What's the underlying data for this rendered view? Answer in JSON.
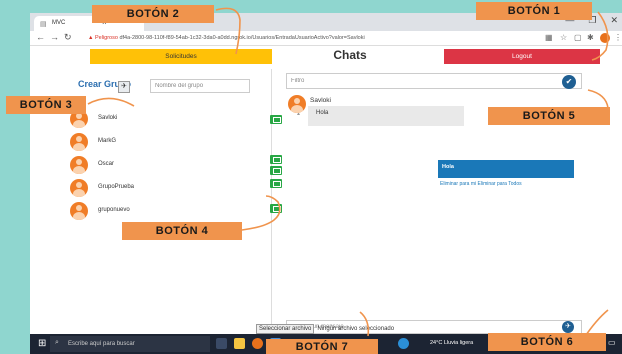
{
  "browser": {
    "tab_title": "MVC",
    "tab_close": "×",
    "new_tab": "+",
    "url_warning": "▲",
    "url_label": "Peligroso",
    "url": "df4a-2800-98-110f-f89-54ab-1c32-3da0-a0dd.ngrok.io/Usuarios/EntradaUsuarioActivo?valor=Savloki",
    "window_controls": [
      "—",
      "❐",
      "✕"
    ]
  },
  "header": {
    "solicitudes_label": "Solicitudes",
    "chats_title": "Chats",
    "logout_label": "Logout"
  },
  "left": {
    "crear_grupo": "Crear Grupo",
    "group_name_placeholder": "Nombre del grupo",
    "users": [
      {
        "name": "Savloki"
      },
      {
        "name": "MarkG"
      },
      {
        "name": "Oscar"
      },
      {
        "name": "GrupoPrueba"
      },
      {
        "name": "gruponuevo"
      }
    ]
  },
  "right": {
    "filtro_placeholder": "Filtro",
    "incoming_message": {
      "sender": "Savloki",
      "text": "Hola"
    },
    "outgoing_message": {
      "text": "Hola",
      "delete_link": "Eliminar para mi Eliminar para Todos"
    },
    "message_placeholder": "Escribe un mensaje",
    "file_button": "Seleccionar archivo",
    "file_status": "Ningún archivo seleccionado"
  },
  "taskbar": {
    "search_placeholder": "Escribe aquí para buscar",
    "weather": "24°C  Lluvia ligera",
    "time": "0:14",
    "date": "9/11/2021"
  },
  "annotations": {
    "b1": "BOTÓN 1",
    "b2": "BOTÓN 2",
    "b3": "BOTÓN 3",
    "b4": "BOTÓN 4",
    "b5": "BOTÓN 5",
    "b6": "BOTÓN 6",
    "b7": "BOTÓN 7"
  },
  "colors": {
    "solicitudes": "#ffc107",
    "logout": "#dc3545",
    "green_button": "#28a745",
    "accent_blue": "#1f5f92",
    "annotation_orange": "#f0944d",
    "background": "#8fd6cf"
  }
}
